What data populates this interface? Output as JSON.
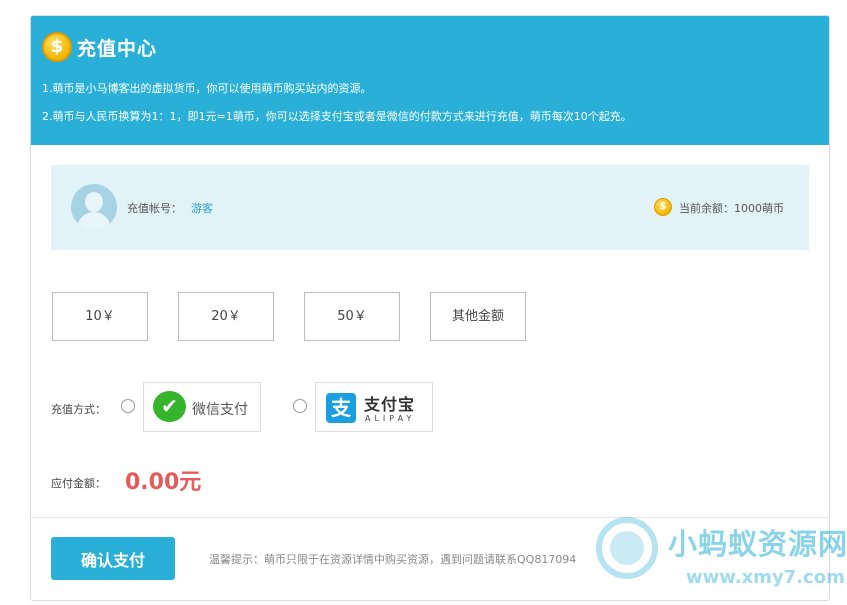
{
  "header": {
    "coin_symbol": "$",
    "title": "充值中心",
    "notes": [
      "1.萌币是小马博客出的虚拟货币，你可以使用萌币购买站内的资源。",
      "2.萌币与人民币换算为1：1，即1元=1萌币，你可以选择支付宝或者是微信的付款方式来进行充值，萌币每次10个起充。"
    ]
  },
  "account": {
    "label": "充值帐号：",
    "username": "游客",
    "coin_symbol": "$",
    "balance_label": "当前余额：1000萌币"
  },
  "amounts": [
    "10￥",
    "20￥",
    "50￥",
    "其他金额"
  ],
  "payment": {
    "label": "充值方式：",
    "wechat": {
      "icon": "wechat-icon",
      "text": "微信支付"
    },
    "alipay": {
      "icon": "alipay-icon",
      "glyph": "支",
      "text_cn": "支付宝",
      "text_en": "ALIPAY"
    }
  },
  "due": {
    "label": "应付金额：",
    "value": "0.00元"
  },
  "confirm_label": "确认支付",
  "tip": "温馨提示：萌币只限于在资源详情中购买资源，遇到问题请联系QQ817094",
  "watermark": {
    "cn": "小蚂蚁资源网",
    "url": "www.xmy7.com"
  },
  "colors": {
    "accent": "#2ab0d8",
    "price": "#e55b5b",
    "wechat": "#36b52c",
    "alipay": "#1a9fe3",
    "coin": "#f3b400"
  }
}
